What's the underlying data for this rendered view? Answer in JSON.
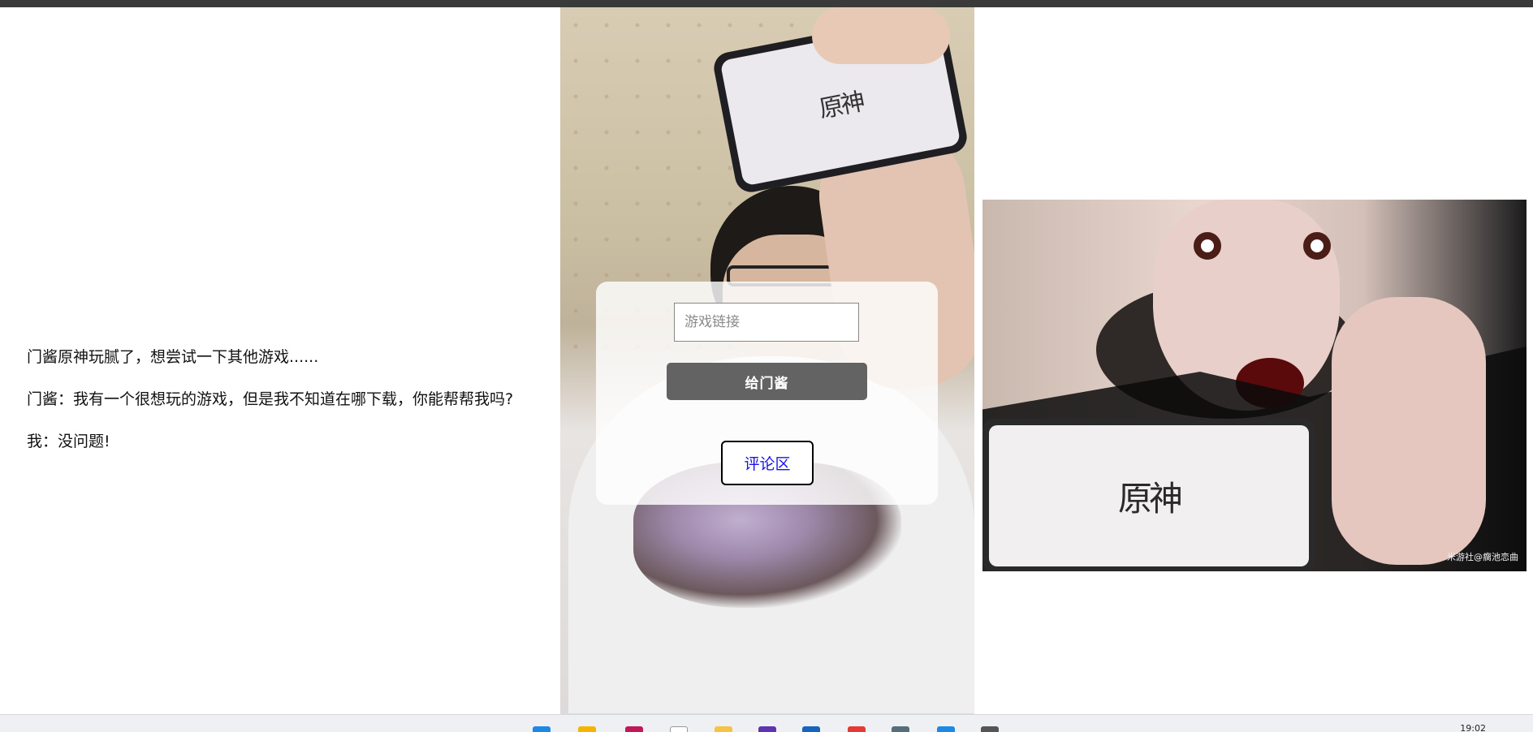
{
  "story": {
    "line1": "门酱原神玩腻了，想尝试一下其他游戏......",
    "line2": "门酱：我有一个很想玩的游戏，但是我不知道在哪下载，你能帮帮我吗?",
    "line3": "我：没问题!"
  },
  "form": {
    "input_placeholder": "游戏链接",
    "input_value": "",
    "send_label": "给门酱",
    "comment_label": "评论区"
  },
  "images": {
    "center_phone_logo": "原神",
    "right_phone_logo": "原神",
    "watermark": "米游社@瘸池恋曲"
  },
  "taskbar": {
    "clock": "19:02",
    "icons": [
      "windows-start-icon",
      "file-explorer-icon",
      "browser-icon",
      "app-icon",
      "folder-icon",
      "editor-icon",
      "store-icon",
      "chrome-icon",
      "app-icon",
      "vscode-icon",
      "terminal-icon"
    ]
  },
  "colors": {
    "send_button_bg": "#636363",
    "comment_text": "#1a10e8",
    "card_bg": "rgba(255,255,255,0.82)"
  }
}
